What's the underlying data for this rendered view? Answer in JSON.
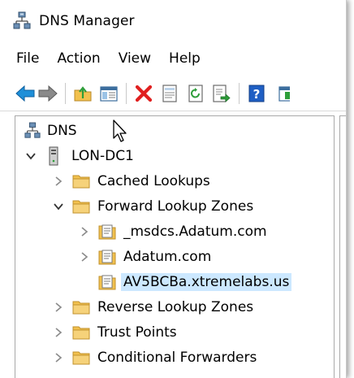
{
  "window": {
    "title": "DNS Manager"
  },
  "menu": [
    "File",
    "Action",
    "View",
    "Help"
  ],
  "toolbar": {
    "buttons": [
      "back-arrow-icon",
      "forward-arrow-icon",
      "up-folder-icon",
      "show-hide-tree-icon",
      "delete-icon",
      "properties-icon",
      "refresh-icon",
      "export-list-icon",
      "help-icon",
      "show-action-pane-icon"
    ]
  },
  "tree": {
    "root": "DNS",
    "server": "LON-DC1",
    "cached_lookups": "Cached Lookups",
    "forward_zones": "Forward Lookup Zones",
    "zone_msdcs": "_msdcs.Adatum.com",
    "zone_adatum": "Adatum.com",
    "zone_selected": "AV5BCBa.xtremelabs.us",
    "reverse_zones": "Reverse Lookup Zones",
    "trust_points": "Trust Points",
    "conditional_forwarders": "Conditional Forwarders"
  },
  "colors": {
    "selection": "#cce8ff",
    "folder": "#f2c14e",
    "back_arrow": "#1e8fd8",
    "delete": "#e02020",
    "help": "#1f5fc4"
  }
}
